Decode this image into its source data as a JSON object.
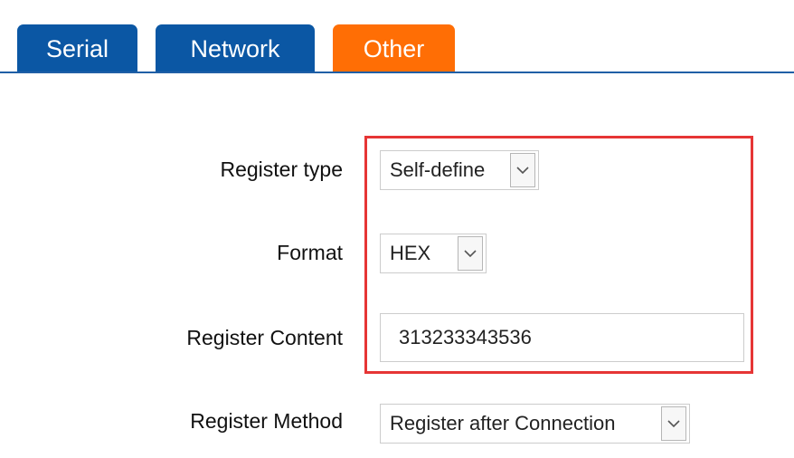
{
  "tabs": [
    {
      "label": "Serial",
      "active": false
    },
    {
      "label": "Network",
      "active": false
    },
    {
      "label": "Other",
      "active": true
    }
  ],
  "colors": {
    "tab_inactive": "#0b57a4",
    "tab_active": "#ff6e05",
    "highlight_border": "#e63535"
  },
  "form": {
    "register_type": {
      "label": "Register type",
      "value": "Self-define"
    },
    "format": {
      "label": "Format",
      "value": "HEX"
    },
    "register_content": {
      "label": "Register Content",
      "value": "313233343536"
    },
    "register_method": {
      "label": "Register Method",
      "value": "Register after Connection"
    }
  },
  "icons": {
    "dropdown": "chevron-down-icon"
  }
}
